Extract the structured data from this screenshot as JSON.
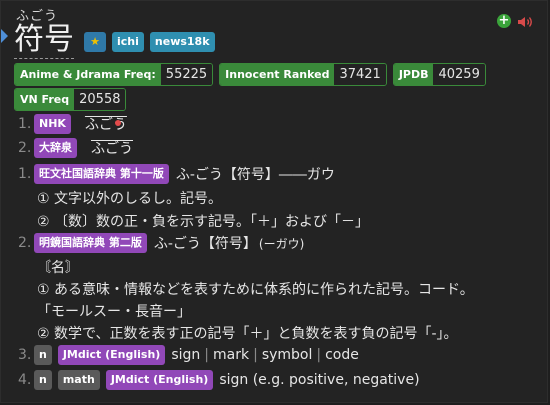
{
  "head": {
    "reading": "ふごう",
    "kanji": "符号",
    "tags": [
      "★",
      "ichi",
      "news18k"
    ]
  },
  "freq": [
    {
      "k": "Anime & Jdrama Freq:",
      "v": "55225"
    },
    {
      "k": "Innocent Ranked",
      "v": "37421"
    },
    {
      "k": "JPDB",
      "v": "40259"
    },
    {
      "k": "VN Freq",
      "v": "20558"
    }
  ],
  "pitch": [
    {
      "n": "1.",
      "src": "NHK",
      "reading": "ふごう"
    },
    {
      "n": "2.",
      "src": "大辞泉",
      "reading": "ふごう"
    }
  ],
  "defs": {
    "d1": {
      "n": "1.",
      "src": "旺文社国語辞典 第十一版",
      "head": "ふ-ごう【符号】――ガウ",
      "l1": "① 文字以外のしるし。記号。",
      "l2": "② 〔数〕数の正・負を示す記号。「＋」および「－」"
    },
    "d2": {
      "n": "2.",
      "src": "明鏡国語辞典 第二版",
      "head": "ふ-ごう【符号】",
      "head_small": "(ーガウ)",
      "l1": "〘名〙",
      "l2": "① ある意味・情報などを表すために体系的に作られた記号。コード。",
      "l3": "「モールスー・長音ー」",
      "l4": "② 数学で、正数を表す正の記号「＋」と負数を表す負の記号「-」。"
    },
    "d3": {
      "n": "3.",
      "pos": "n",
      "src": "JMdict (English)",
      "glosses": [
        "sign",
        "mark",
        "symbol",
        "code"
      ],
      "sep": "|"
    },
    "d4": {
      "n": "4.",
      "pos": "n",
      "misc": "math",
      "src": "JMdict (English)",
      "gloss": "sign (e.g. positive, negative)"
    }
  }
}
